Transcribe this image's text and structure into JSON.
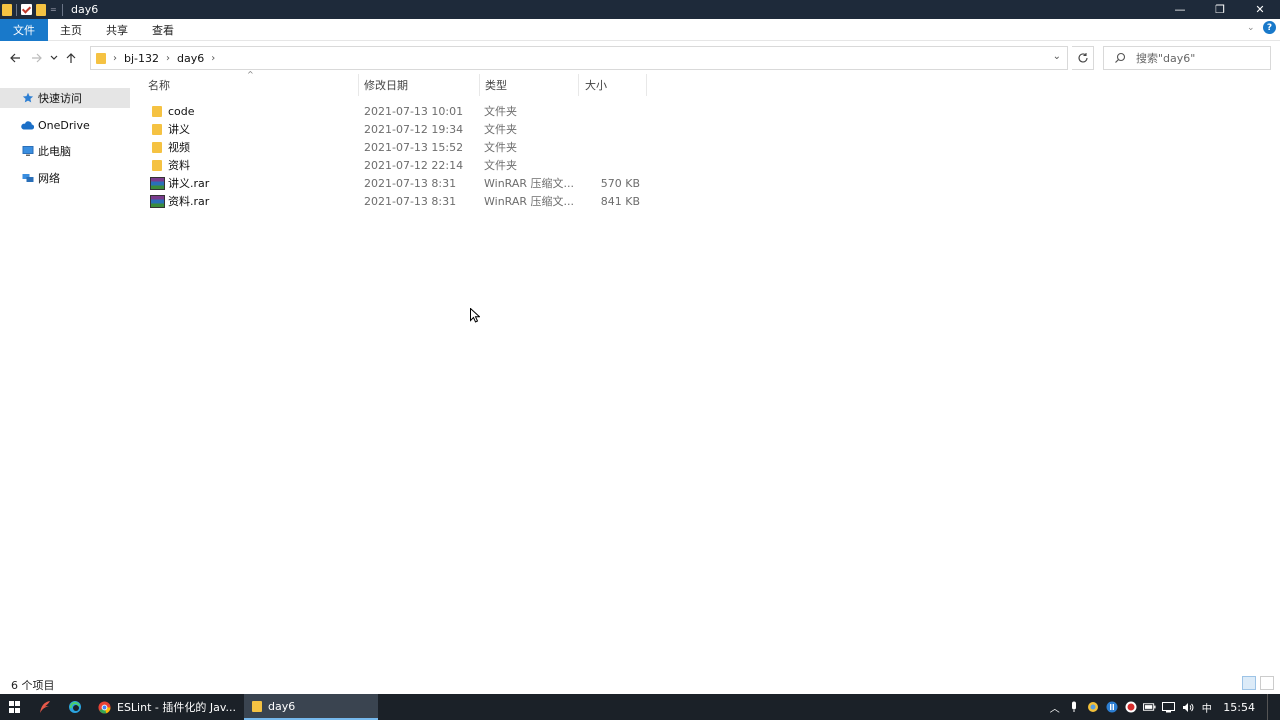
{
  "window": {
    "title": "day6",
    "controls": {
      "minimize": "—",
      "restore": "❐",
      "close": "✕"
    }
  },
  "ribbon": {
    "tabs": [
      "文件",
      "主页",
      "共享",
      "查看"
    ]
  },
  "address": {
    "crumbs": [
      "bj-132",
      "day6"
    ]
  },
  "search": {
    "placeholder": "搜索\"day6\""
  },
  "nav_pane": {
    "items": [
      {
        "label": "快速访问",
        "icon": "star-icon"
      },
      {
        "label": "OneDrive",
        "icon": "cloud-icon"
      },
      {
        "label": "此电脑",
        "icon": "computer-icon"
      },
      {
        "label": "网络",
        "icon": "network-icon"
      }
    ]
  },
  "columns": {
    "name": "名称",
    "date": "修改日期",
    "type": "类型",
    "size": "大小"
  },
  "files": [
    {
      "name": "code",
      "date": "2021-07-13 10:01",
      "type": "文件夹",
      "size": "",
      "kind": "folder"
    },
    {
      "name": "讲义",
      "date": "2021-07-12 19:34",
      "type": "文件夹",
      "size": "",
      "kind": "folder"
    },
    {
      "name": "视频",
      "date": "2021-07-13 15:52",
      "type": "文件夹",
      "size": "",
      "kind": "folder"
    },
    {
      "name": "资料",
      "date": "2021-07-12 22:14",
      "type": "文件夹",
      "size": "",
      "kind": "folder"
    },
    {
      "name": "讲义.rar",
      "date": "2021-07-13 8:31",
      "type": "WinRAR 压缩文...",
      "size": "570 KB",
      "kind": "rar"
    },
    {
      "name": "资料.rar",
      "date": "2021-07-13 8:31",
      "type": "WinRAR 压缩文...",
      "size": "841 KB",
      "kind": "rar"
    }
  ],
  "status": {
    "count_text": "6 个项目"
  },
  "taskbar": {
    "apps": [
      {
        "label": "ESLint - 插件化的 Jav...",
        "icon": "chrome-icon"
      },
      {
        "label": "day6",
        "icon": "folder-icon"
      }
    ],
    "tray": {
      "ime": "中",
      "clock": "15:54"
    }
  },
  "colors": {
    "title_bar": "#1e2a3a",
    "file_tab": "#1979ca",
    "folder": "#f5c242",
    "taskbar": "#1b2128"
  }
}
